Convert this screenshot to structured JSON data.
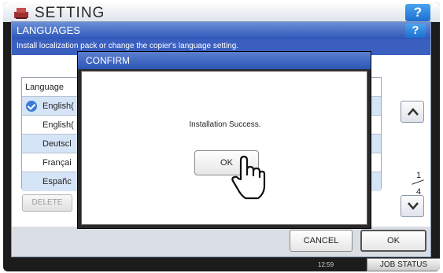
{
  "app": {
    "title": "SETTING",
    "help_label": "?"
  },
  "languages_panel": {
    "title": "LANGUAGES",
    "help_label": "?",
    "instruction": "Install localization pack or change the copier's language setting."
  },
  "language_table": {
    "header": "Language",
    "rows": [
      {
        "label": "English(",
        "selected": true
      },
      {
        "label": "English("
      },
      {
        "label": "Deutscl"
      },
      {
        "label": "Françai"
      },
      {
        "label": "Españc"
      }
    ]
  },
  "pagination": {
    "current": "1",
    "total": "4"
  },
  "actions": {
    "delete_label": "DELETE",
    "cancel_label": "CANCEL",
    "ok_label": "OK"
  },
  "dialog": {
    "title": "CONFIRM",
    "message": "Installation Success.",
    "ok_label": "OK"
  },
  "status_bar": {
    "time": "12:59",
    "job_status_label": "JOB STATUS"
  },
  "colors": {
    "accent_blue": "#2c55b8",
    "row_alt": "#d6e4f7",
    "frame": "#1c1c1c"
  },
  "icons": {
    "check": "check-icon",
    "scroll_up": "chevron-up-icon",
    "scroll_down": "chevron-down-icon",
    "pointer": "hand-pointer-icon"
  }
}
